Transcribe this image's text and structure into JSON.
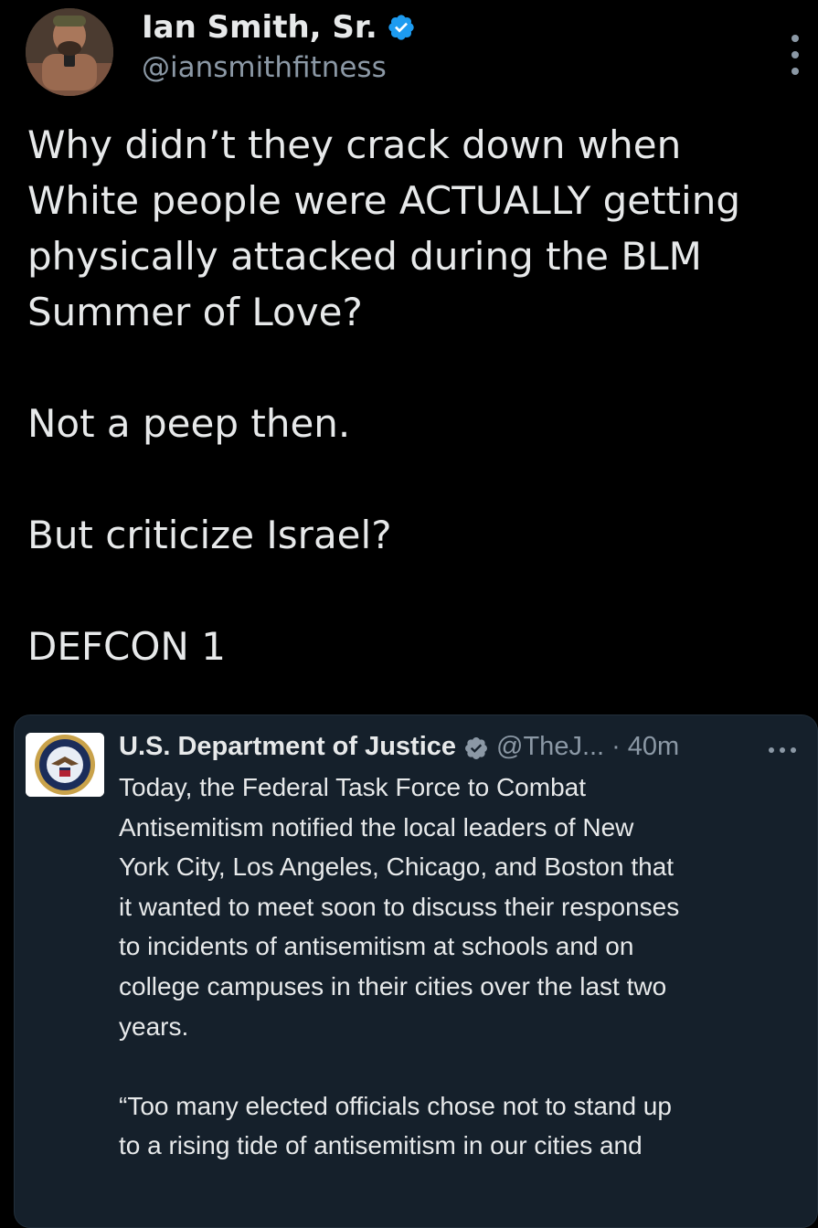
{
  "tweet": {
    "author_name": "Ian Smith, Sr.",
    "author_handle": "@iansmithfitness",
    "text": "Why didn’t they crack down when\nWhite people were ACTUALLY getting\nphysically attacked during the BLM\nSummer of Love?\n\nNot a peep then.\n\nBut criticize Israel?\n\nDEFCON 1"
  },
  "quoted_tweet": {
    "author_name": "U.S. Department of Justice",
    "author_handle": "@TheJ...",
    "separator": "·",
    "time": "40m",
    "text": "Today, the Federal Task Force to Combat\nAntisemitism notified the local leaders of New\nYork City, Los Angeles, Chicago, and Boston that\nit wanted to meet soon to discuss their responses\nto incidents of antisemitism at schools and on\ncollege campuses in their cities over the last two\nyears.\n\n“Too many elected officials chose not to stand up\nto a rising tide of antisemitism in our cities and",
    "logo_text": "DEPARTMENT OF JUSTICE"
  },
  "colors": {
    "background": "#000000",
    "text": "#e7e9ea",
    "secondary_text": "#8b98a5",
    "verified_blue": "#1d9bf0",
    "quote_card_background": "#15202b"
  },
  "icons": {
    "verified": "verified-badge-icon",
    "more": "more-vertical-icon",
    "quote_more": "more-horizontal-icon"
  }
}
